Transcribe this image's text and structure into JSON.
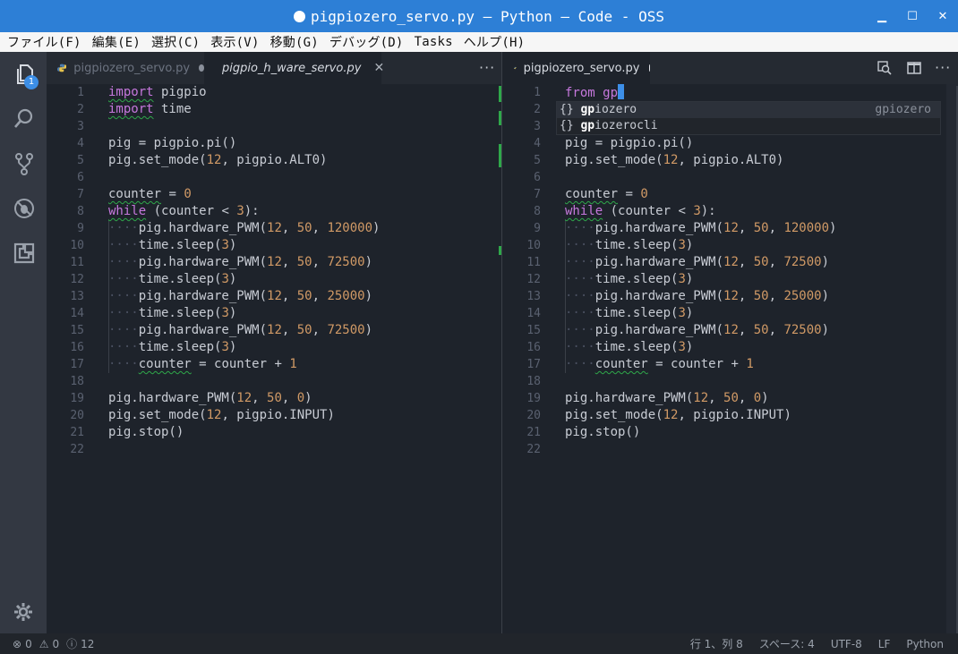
{
  "window": {
    "title": "pigpiozero_servo.py — Python — Code - OSS"
  },
  "menu": [
    "ファイル(F)",
    "編集(E)",
    "選択(C)",
    "表示(V)",
    "移動(G)",
    "デバッグ(D)",
    "Tasks",
    "ヘルプ(H)"
  ],
  "activity": {
    "explorer_badge": "1"
  },
  "left_group": {
    "tabs": [
      {
        "label": "pigpiozero_servo.py",
        "state": "inactive, unsaved"
      },
      {
        "label": "pigpio_h_ware_servo.py",
        "state": "active"
      }
    ]
  },
  "right_group": {
    "tabs": [
      {
        "label": "pigpiozero_servo.py",
        "state": "active, unsaved"
      }
    ]
  },
  "suggest": {
    "items": [
      {
        "icon": "{}",
        "match": "gp",
        "rest": "iozero",
        "detail": "gpiozero"
      },
      {
        "icon": "{}",
        "match": "gp",
        "rest": "iozerocli",
        "detail": ""
      }
    ]
  },
  "right_first_line": "from gp",
  "line_numbers": [
    "1",
    "2",
    "3",
    "4",
    "5",
    "6",
    "7",
    "8",
    "9",
    "10",
    "11",
    "12",
    "13",
    "14",
    "15",
    "16",
    "17",
    "18",
    "19",
    "20",
    "21",
    "22"
  ],
  "statusbar": {
    "errors": "0",
    "warnings": "0",
    "info": "12",
    "position": "行 1、列 8",
    "spaces": "スペース: 4",
    "encoding": "UTF-8",
    "eol": "LF",
    "language": "Python"
  },
  "colors": {
    "titlebar": "#2d7fd6",
    "editor_bg": "#1e232b",
    "keyword": "#c678dd",
    "number": "#d19a66",
    "git_added": "#2fa84a"
  }
}
